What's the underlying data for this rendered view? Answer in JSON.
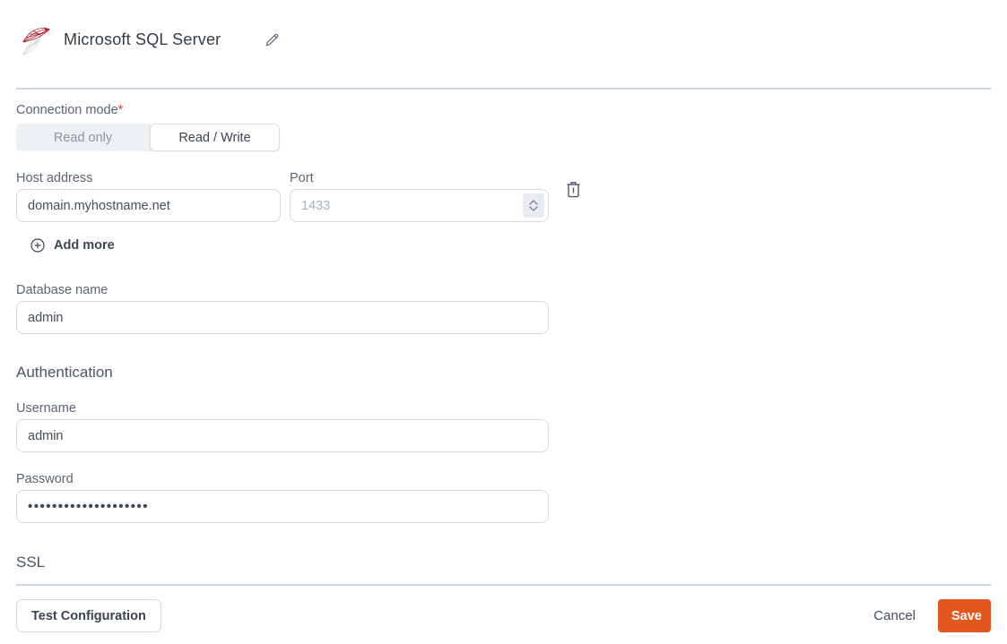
{
  "header": {
    "title": "Microsoft SQL Server"
  },
  "form": {
    "connection_mode": {
      "label": "Connection mode",
      "required_mark": "*",
      "options": [
        {
          "label": "Read only",
          "selected": false
        },
        {
          "label": "Read / Write",
          "selected": true
        }
      ]
    },
    "host": {
      "label": "Host address",
      "value": "domain.myhostname.net"
    },
    "port": {
      "label": "Port",
      "placeholder": "1433"
    },
    "add_more": {
      "label": "Add more"
    },
    "database": {
      "label": "Database name",
      "value": "admin"
    },
    "authentication": {
      "heading": "Authentication",
      "username": {
        "label": "Username",
        "value": "admin"
      },
      "password": {
        "label": "Password",
        "value": "••••••••••••••••••••"
      }
    },
    "ssl": {
      "heading": "SSL"
    }
  },
  "footer": {
    "test_button": "Test Configuration",
    "cancel_button": "Cancel",
    "save_button": "Save"
  },
  "icons": {
    "logo": "sql-server-logo",
    "edit": "pencil-icon",
    "add": "plus-circle-icon",
    "delete": "trash-icon",
    "stepper": "number-stepper-icon"
  },
  "colors": {
    "accent_orange": "#e2571e",
    "required_red": "#e03c3c",
    "divider": "#cdd6de",
    "logo_red": "#b52025"
  }
}
